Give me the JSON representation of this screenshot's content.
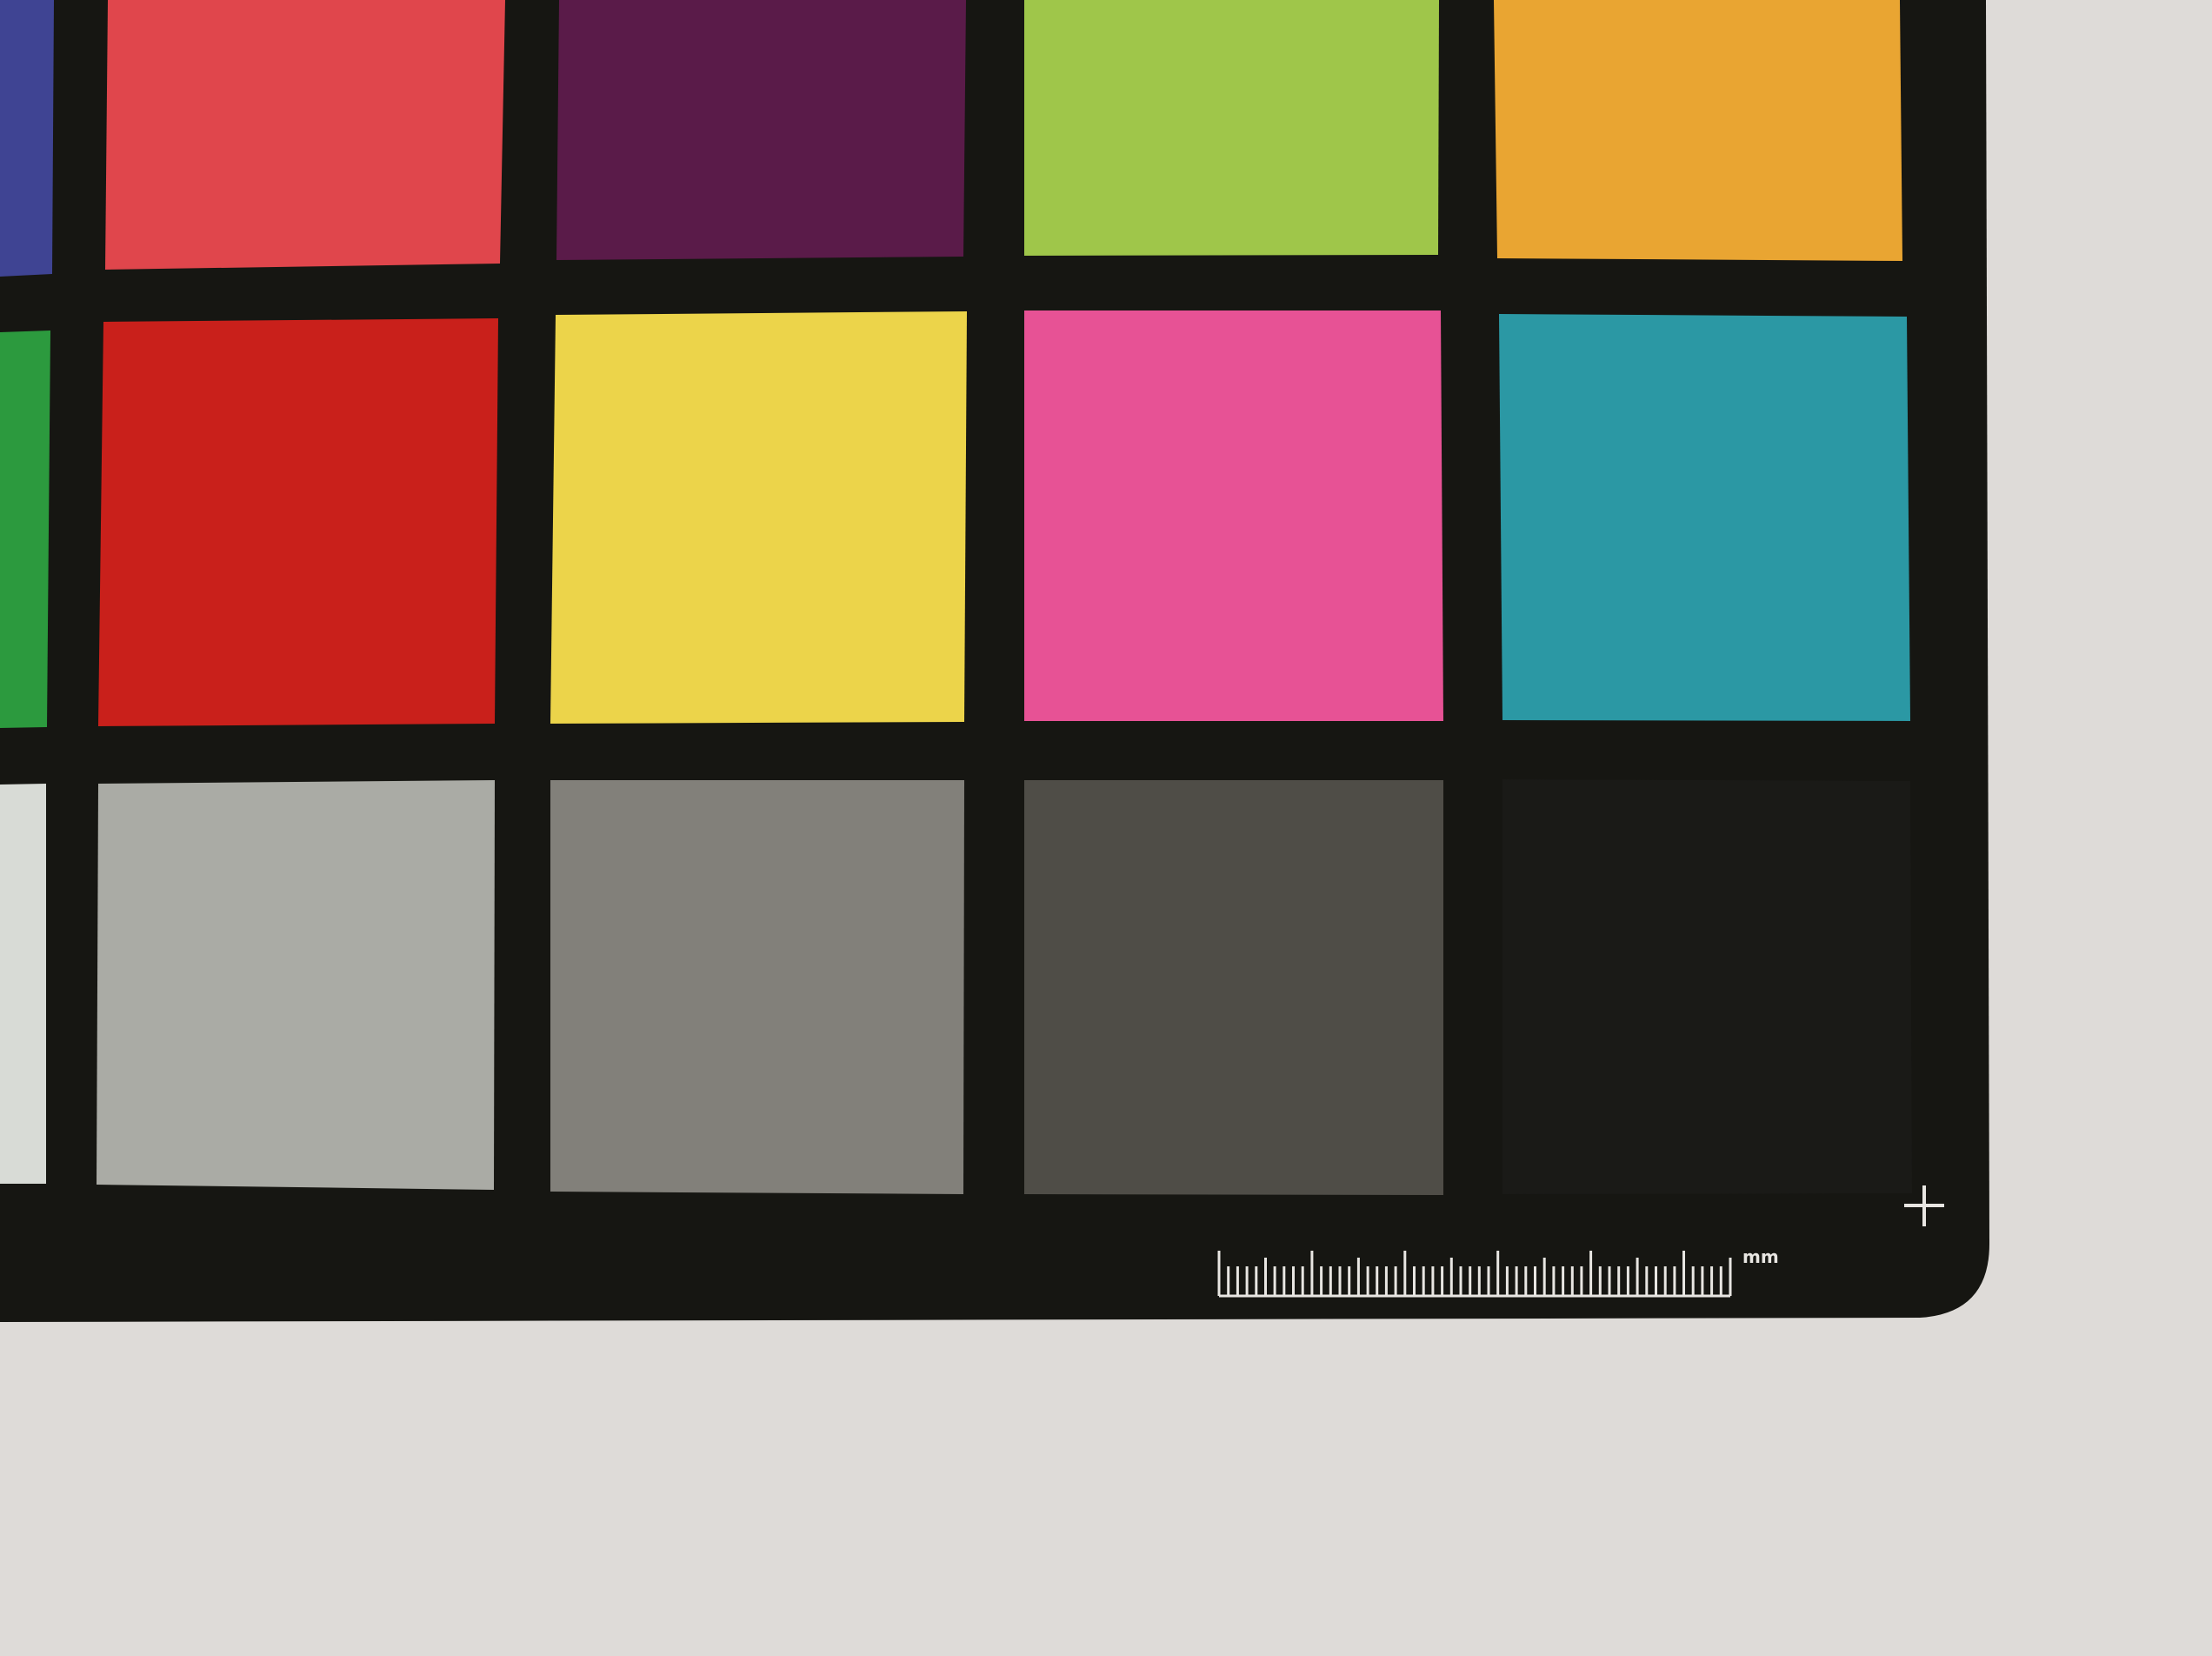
{
  "scene": {
    "background_color": "#dedbd8",
    "card_color": "#161612"
  },
  "patches": [
    {
      "name": "top-blue",
      "color": "#3f4493"
    },
    {
      "name": "top-red-pink",
      "color": "#e0464c"
    },
    {
      "name": "top-purple",
      "color": "#5a1b49"
    },
    {
      "name": "top-green",
      "color": "#9fc64a"
    },
    {
      "name": "top-orange",
      "color": "#e9a532"
    },
    {
      "name": "mid-green",
      "color": "#2c9a3e"
    },
    {
      "name": "mid-red",
      "color": "#c9201b"
    },
    {
      "name": "mid-yellow",
      "color": "#ecd44a"
    },
    {
      "name": "mid-magenta",
      "color": "#e75295"
    },
    {
      "name": "mid-cyan",
      "color": "#2b98a4"
    },
    {
      "name": "bot-white",
      "color": "#d8dbd6"
    },
    {
      "name": "bot-gray-1",
      "color": "#aaaba5"
    },
    {
      "name": "bot-gray-2",
      "color": "#82807a"
    },
    {
      "name": "bot-gray-3",
      "color": "#4f4d47"
    },
    {
      "name": "bot-black",
      "color": "#1a1a17"
    }
  ],
  "ruler": {
    "unit_label": "mm",
    "tick_count": 56,
    "color": "#e8e6e2"
  }
}
